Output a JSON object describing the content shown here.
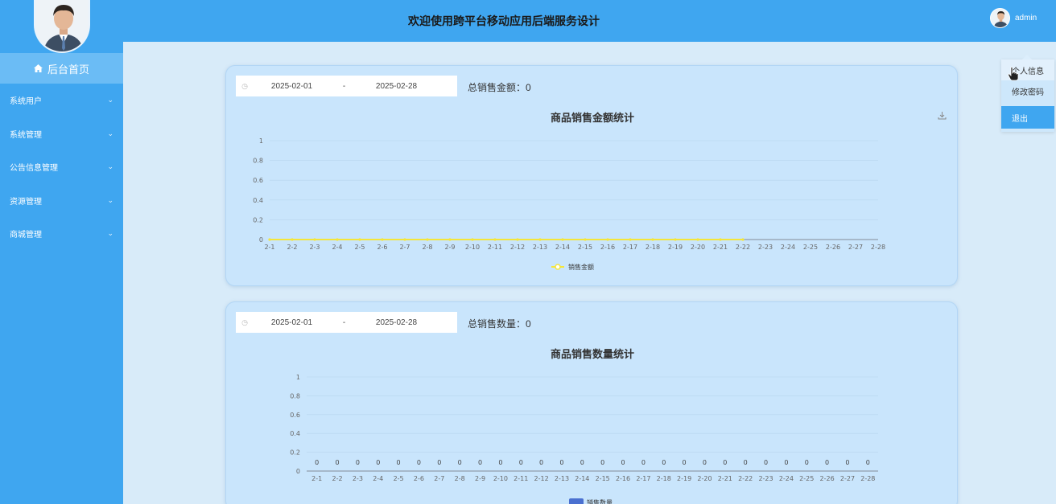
{
  "app": {
    "title": "欢迎使用跨平台移动应用后端服务设计",
    "user": "admin",
    "accent": "#3fa6f0"
  },
  "sidebar": {
    "home": "后台首页",
    "items": [
      {
        "label": "系统用户"
      },
      {
        "label": "系统管理"
      },
      {
        "label": "公告信息管理"
      },
      {
        "label": "资源管理"
      },
      {
        "label": "商城管理"
      }
    ]
  },
  "dropdown": {
    "items": [
      "个人信息",
      "修改密码",
      "退出"
    ]
  },
  "sales_amount": {
    "start": "2025-02-01",
    "separator": "-",
    "end": "2025-02-28",
    "total_label": "总销售金额：",
    "total_value": "0"
  },
  "sales_count": {
    "start": "2025-02-01",
    "separator": "-",
    "end": "2025-02-28",
    "total_label": "总销售数量：",
    "total_value": "0"
  },
  "chart_data": [
    {
      "type": "line",
      "title": "商品销售金额统计",
      "x": [
        "2-1",
        "2-2",
        "2-3",
        "2-4",
        "2-5",
        "2-6",
        "2-7",
        "2-8",
        "2-9",
        "2-10",
        "2-11",
        "2-12",
        "2-13",
        "2-14",
        "2-15",
        "2-16",
        "2-17",
        "2-18",
        "2-19",
        "2-20",
        "2-21",
        "2-22",
        "2-23",
        "2-24",
        "2-25",
        "2-26",
        "2-27",
        "2-28"
      ],
      "series": [
        {
          "name": "销售金额",
          "color": "#f5e63a",
          "values": [
            0,
            0,
            0,
            0,
            0,
            0,
            0,
            0,
            0,
            0,
            0,
            0,
            0,
            0,
            0,
            0,
            0,
            0,
            0,
            0,
            0,
            0,
            null,
            null,
            null,
            null,
            null,
            null
          ]
        }
      ],
      "yticks": [
        "0",
        "0.2",
        "0.4",
        "0.6",
        "0.8",
        "1"
      ],
      "ylim": [
        0,
        1
      ],
      "legend": "bottom"
    },
    {
      "type": "bar",
      "title": "商品销售数量统计",
      "x": [
        "2-1",
        "2-2",
        "2-3",
        "2-4",
        "2-5",
        "2-6",
        "2-7",
        "2-8",
        "2-9",
        "2-10",
        "2-11",
        "2-12",
        "2-13",
        "2-14",
        "2-15",
        "2-16",
        "2-17",
        "2-18",
        "2-19",
        "2-20",
        "2-21",
        "2-22",
        "2-23",
        "2-24",
        "2-25",
        "2-26",
        "2-27",
        "2-28"
      ],
      "series": [
        {
          "name": "销售数量",
          "color": "#4a70d0",
          "values": [
            0,
            0,
            0,
            0,
            0,
            0,
            0,
            0,
            0,
            0,
            0,
            0,
            0,
            0,
            0,
            0,
            0,
            0,
            0,
            0,
            0,
            0,
            0,
            0,
            0,
            0,
            0,
            0
          ]
        }
      ],
      "yticks": [
        "0",
        "0.2",
        "0.4",
        "0.6",
        "0.8",
        "1"
      ],
      "ylim": [
        0,
        1
      ],
      "legend": "bottom"
    }
  ]
}
